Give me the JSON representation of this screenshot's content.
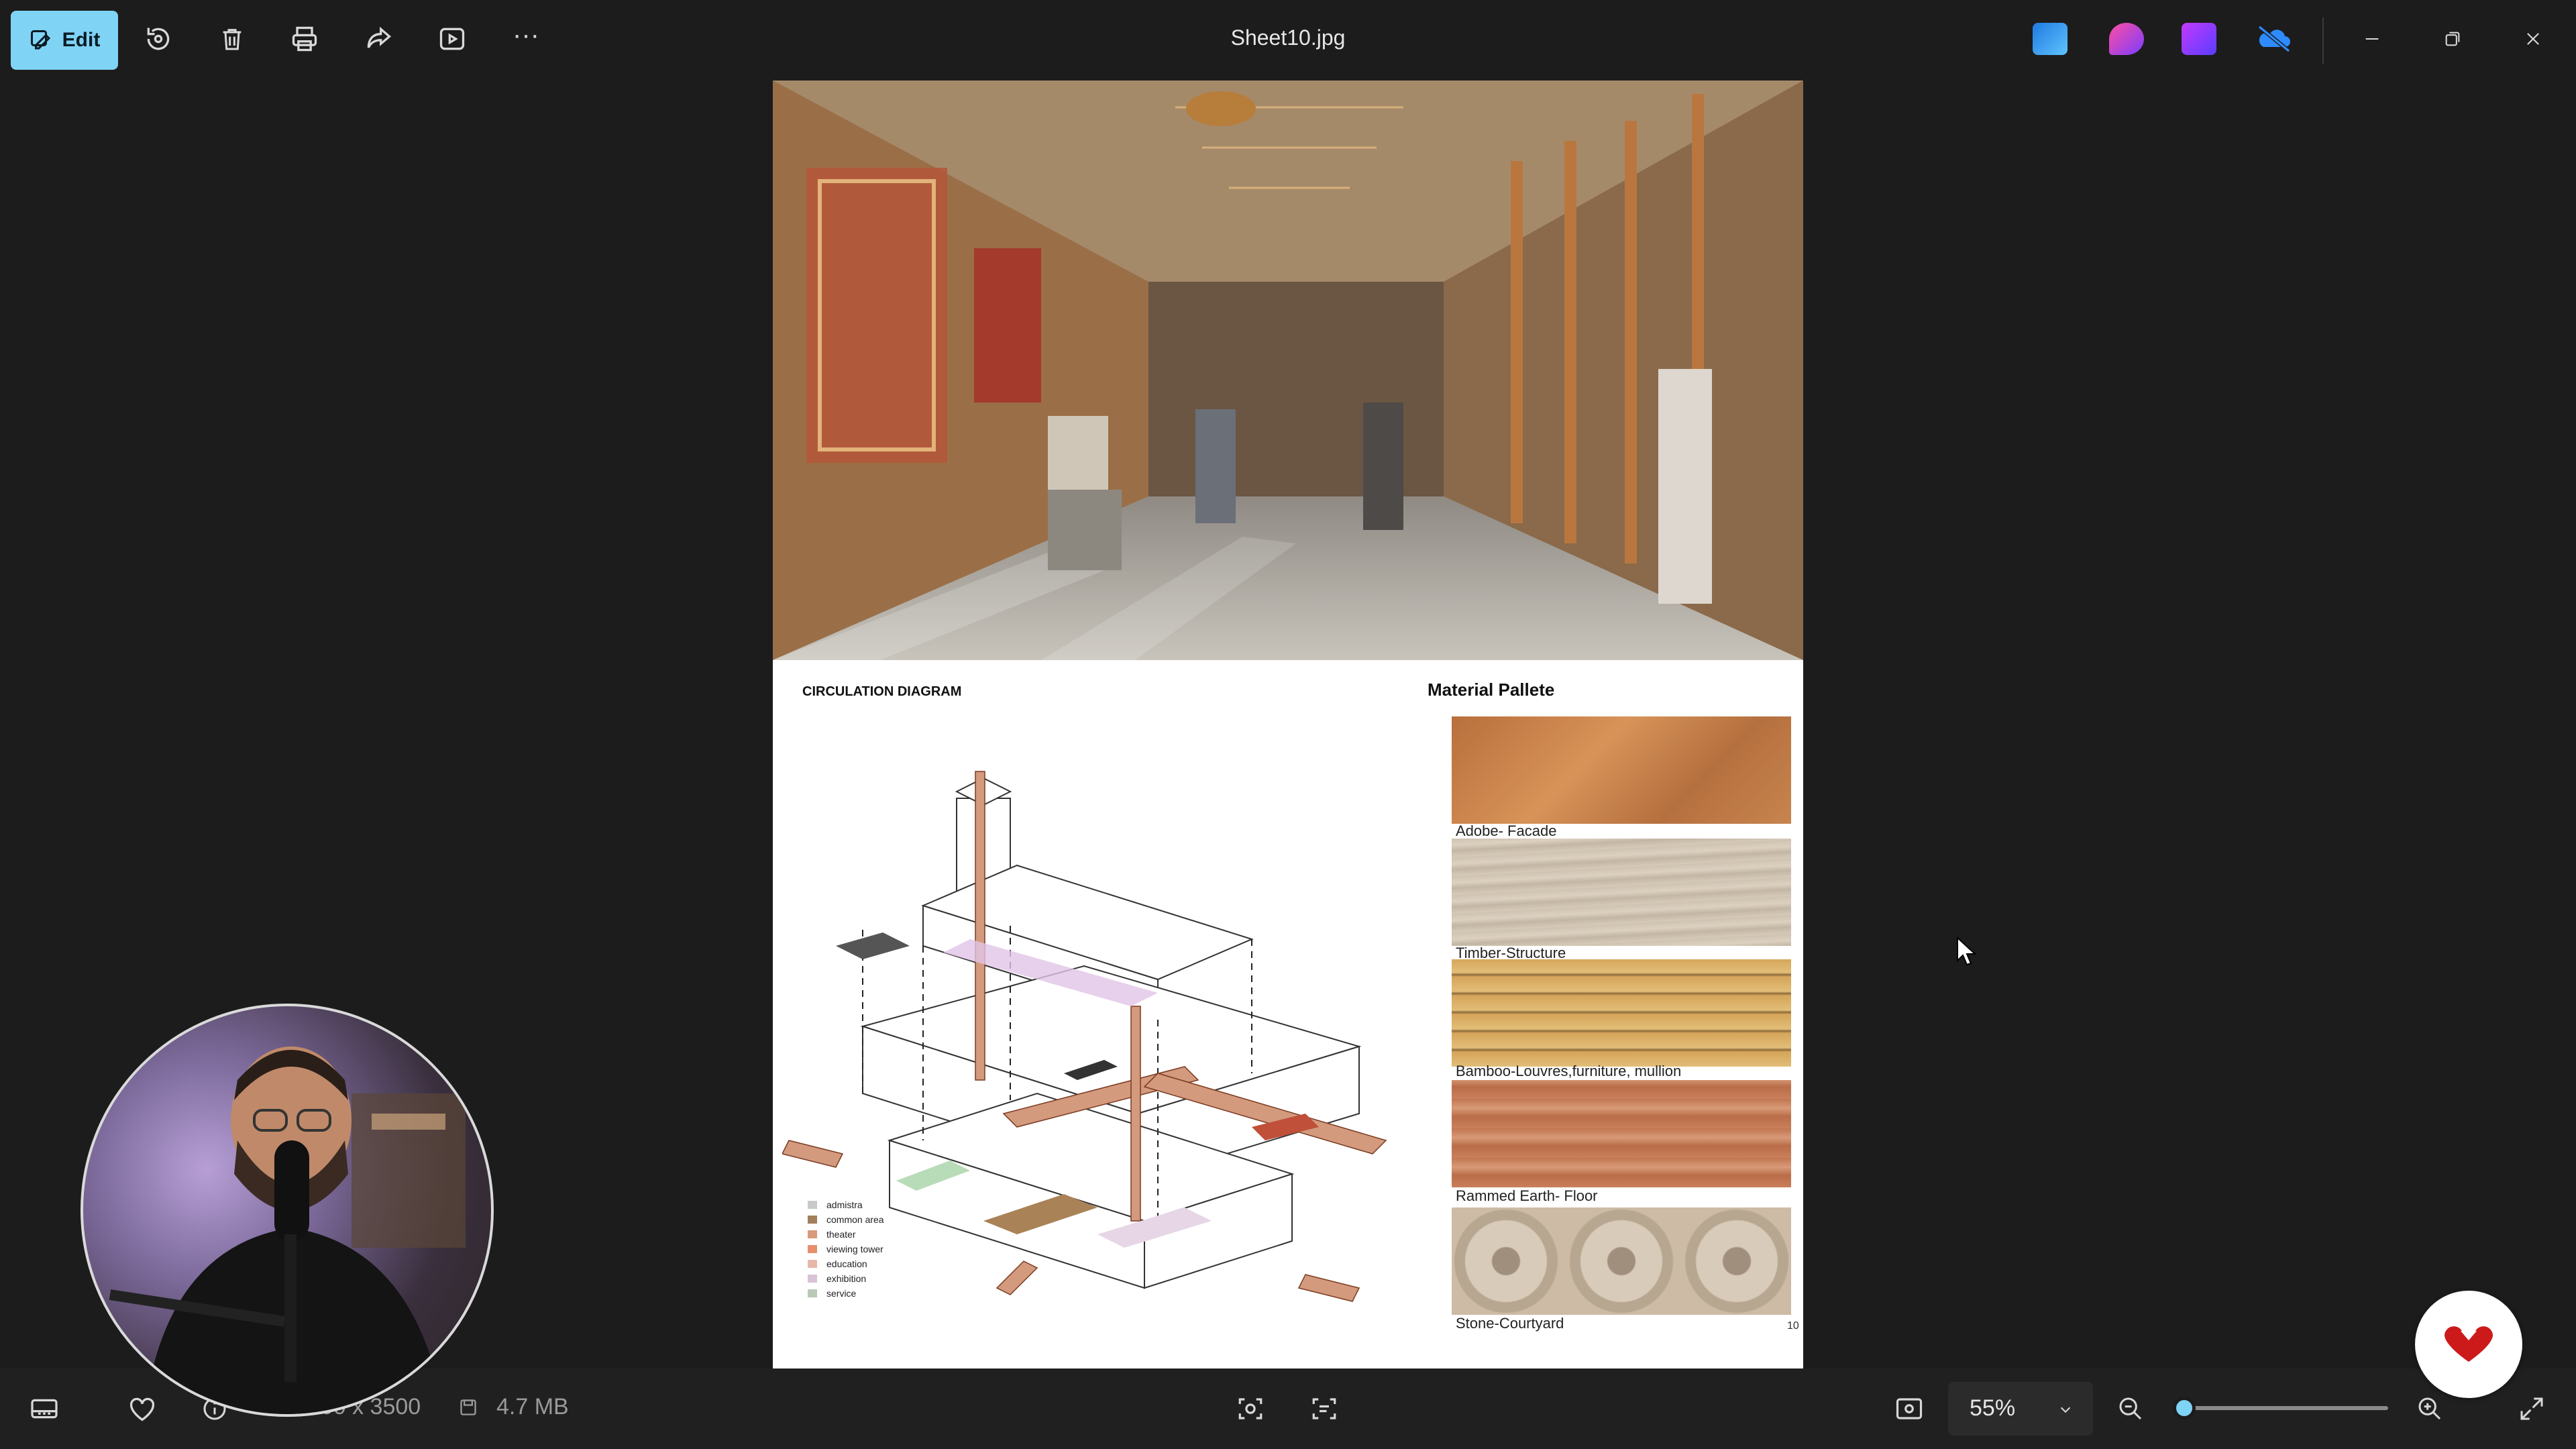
{
  "toolbar": {
    "edit_label": "Edit",
    "file_title": "Sheet10.jpg",
    "more_label": "···"
  },
  "colors": {
    "accent": "#7fd3f5",
    "bar_bg": "#202020",
    "window_bg": "#1c1c1c"
  },
  "sheet": {
    "circulation_title": "CIRCULATION DIAGRAM",
    "palette_title": "Material Pallete",
    "page_number": "10",
    "materials": [
      {
        "label": "Adobe- Facade",
        "color": "#c07a45"
      },
      {
        "label": "Timber-Structure",
        "color": "#cdbfae"
      },
      {
        "label": "Bamboo-Louvres,furniture, mullion",
        "color": "#d9b06a"
      },
      {
        "label": "Rammed Earth- Floor",
        "color": "#c57a55"
      },
      {
        "label": "Stone-Courtyard",
        "color": "#cbb8a4"
      }
    ],
    "legend": [
      {
        "label": "admistra",
        "color": "#c9c9c9"
      },
      {
        "label": "common area",
        "color": "#a07f5a"
      },
      {
        "label": "theater",
        "color": "#d89a7a"
      },
      {
        "label": "viewing tower",
        "color": "#e58f6e"
      },
      {
        "label": "education",
        "color": "#e7b8a8"
      },
      {
        "label": "exhibition",
        "color": "#d8c3d8"
      },
      {
        "label": "service",
        "color": "#b9c9b6"
      }
    ]
  },
  "statusbar": {
    "dimensions": "2500 x 3500",
    "file_size": "4.7 MB",
    "zoom": "55%",
    "zoom_fraction": 0.05
  },
  "icons": {
    "rotate": "rotate-icon",
    "delete": "trash-icon",
    "print": "printer-icon",
    "share": "share-icon",
    "slideshow": "slideshow-icon"
  }
}
